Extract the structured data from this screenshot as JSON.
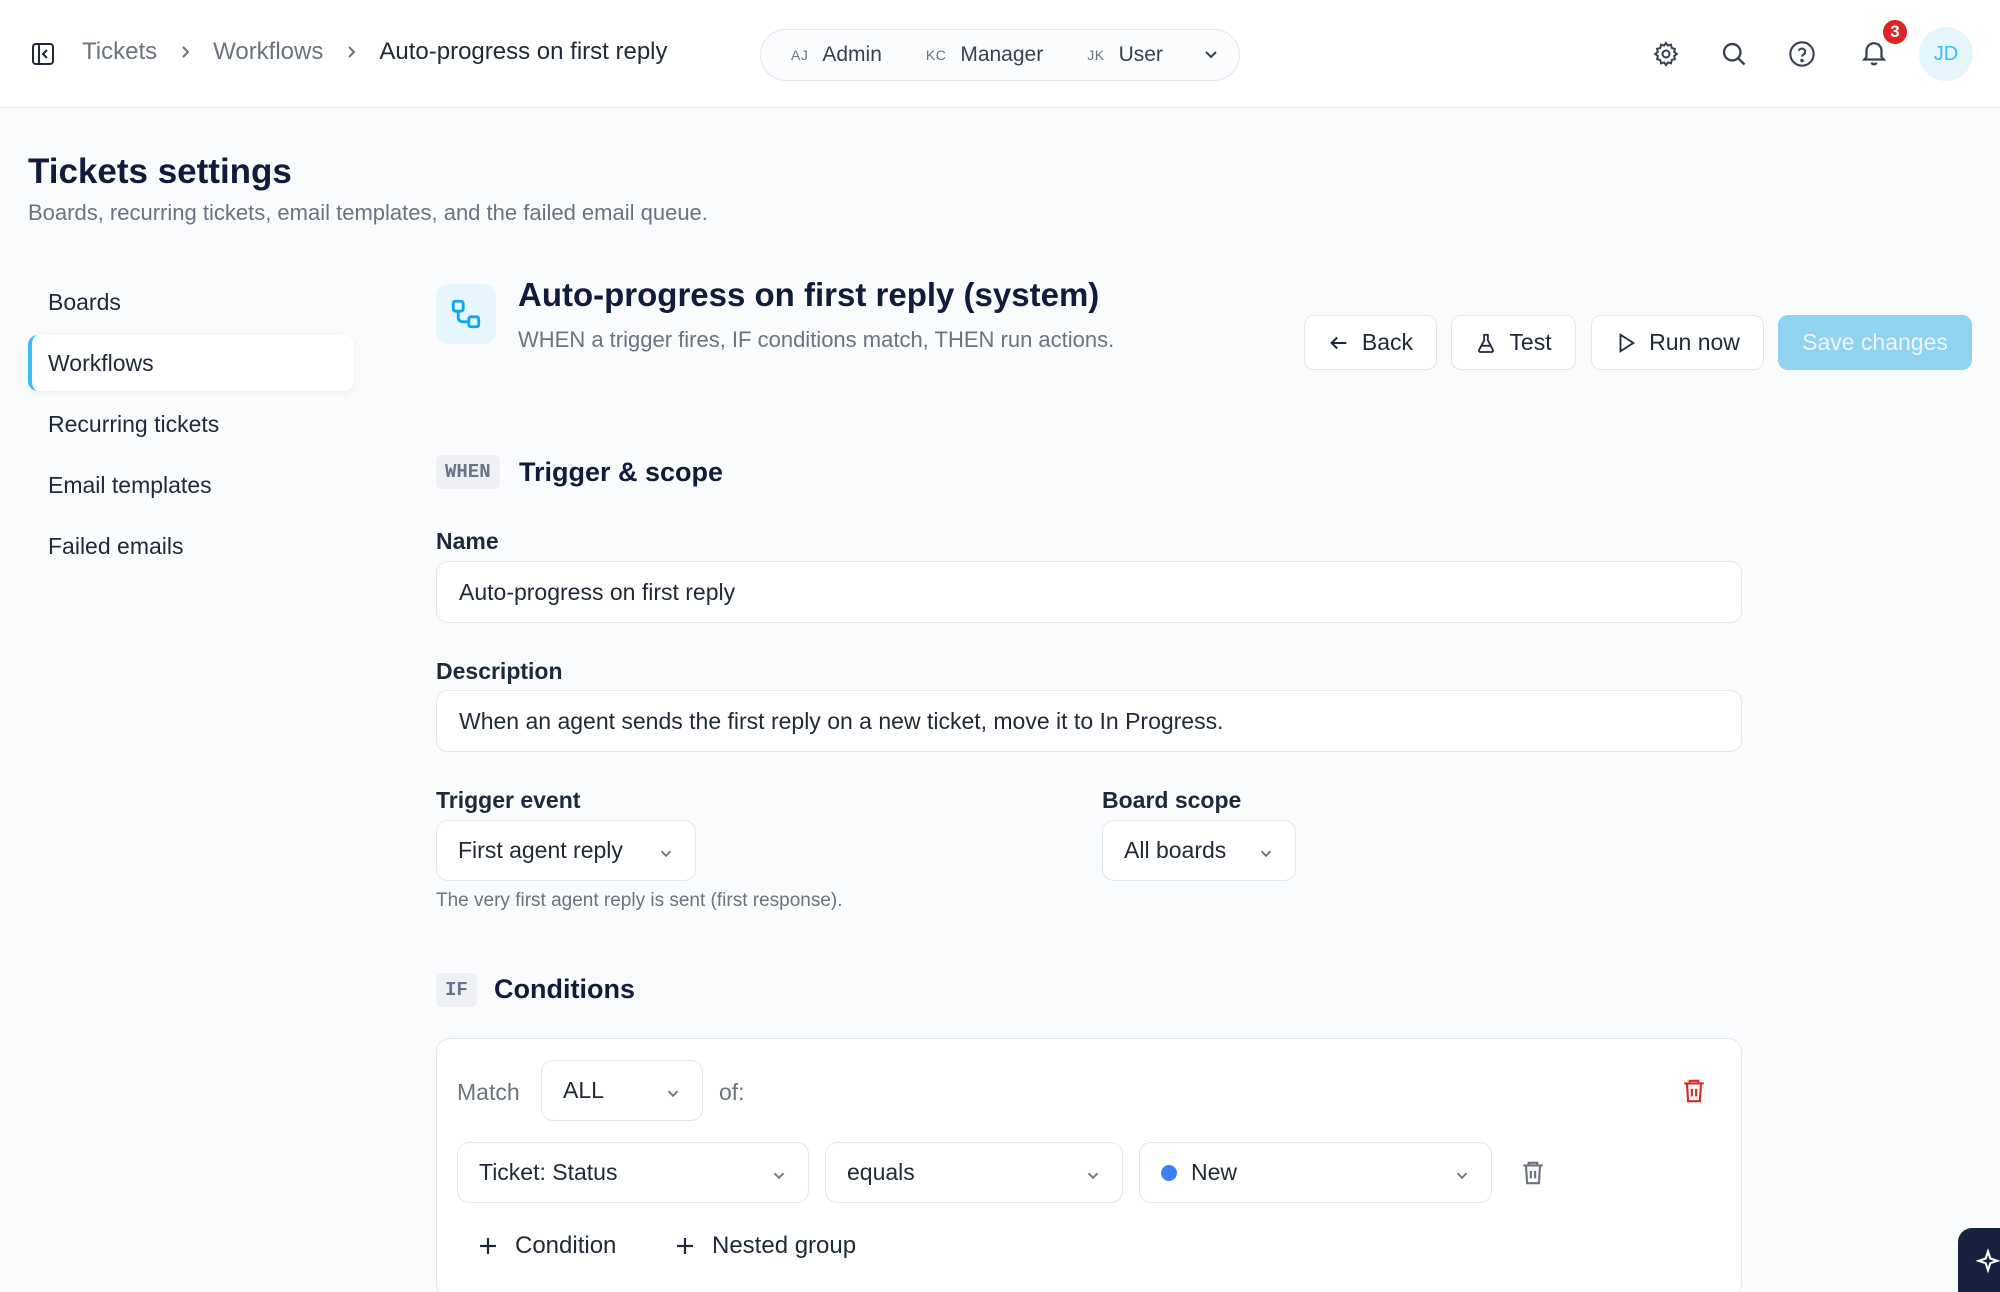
{
  "topbar": {
    "breadcrumbs": [
      "Tickets",
      "Workflows",
      "Auto-progress on first reply"
    ],
    "roles": [
      {
        "initials": "AJ",
        "name": "Admin"
      },
      {
        "initials": "KC",
        "name": "Manager"
      },
      {
        "initials": "JK",
        "name": "User"
      }
    ],
    "notification_count": "3",
    "avatar_initials": "JD",
    "icons": [
      "sidebar-toggle-icon",
      "gear-icon",
      "search-icon",
      "help-icon",
      "bell-icon"
    ]
  },
  "page": {
    "title": "Tickets settings",
    "subtitle": "Boards, recurring tickets, email templates, and the failed email queue."
  },
  "nav": {
    "items": [
      "Boards",
      "Workflows",
      "Recurring tickets",
      "Email templates",
      "Failed emails"
    ],
    "active": "Workflows"
  },
  "workflow": {
    "title": "Auto-progress on first reply (system)",
    "subtitle": "WHEN a trigger fires, IF conditions match, THEN run actions.",
    "buttons": {
      "back": "Back",
      "test": "Test",
      "run_now": "Run now",
      "save": "Save changes"
    }
  },
  "trigger_section": {
    "tag": "WHEN",
    "title": "Trigger & scope",
    "name_label": "Name",
    "name_value": "Auto-progress on first reply",
    "description_label": "Description",
    "description_value": "When an agent sends the first reply on a new ticket, move it to In Progress.",
    "trigger_event_label": "Trigger event",
    "trigger_event_value": "First agent reply",
    "trigger_hint": "The very first agent reply is sent (first response).",
    "board_scope_label": "Board scope",
    "board_scope_value": "All boards"
  },
  "conditions_section": {
    "tag": "IF",
    "title": "Conditions",
    "match_label": "Match",
    "match_value": "ALL",
    "of_label": "of:",
    "condition": {
      "field": "Ticket: Status",
      "operator": "equals",
      "value": "New",
      "value_color": "#3b82f6"
    },
    "add_condition": "Condition",
    "add_group": "Nested group"
  },
  "colors": {
    "accent": "#38bdf8",
    "danger": "#dc2626",
    "save_disabled": "#8fd3f1"
  }
}
